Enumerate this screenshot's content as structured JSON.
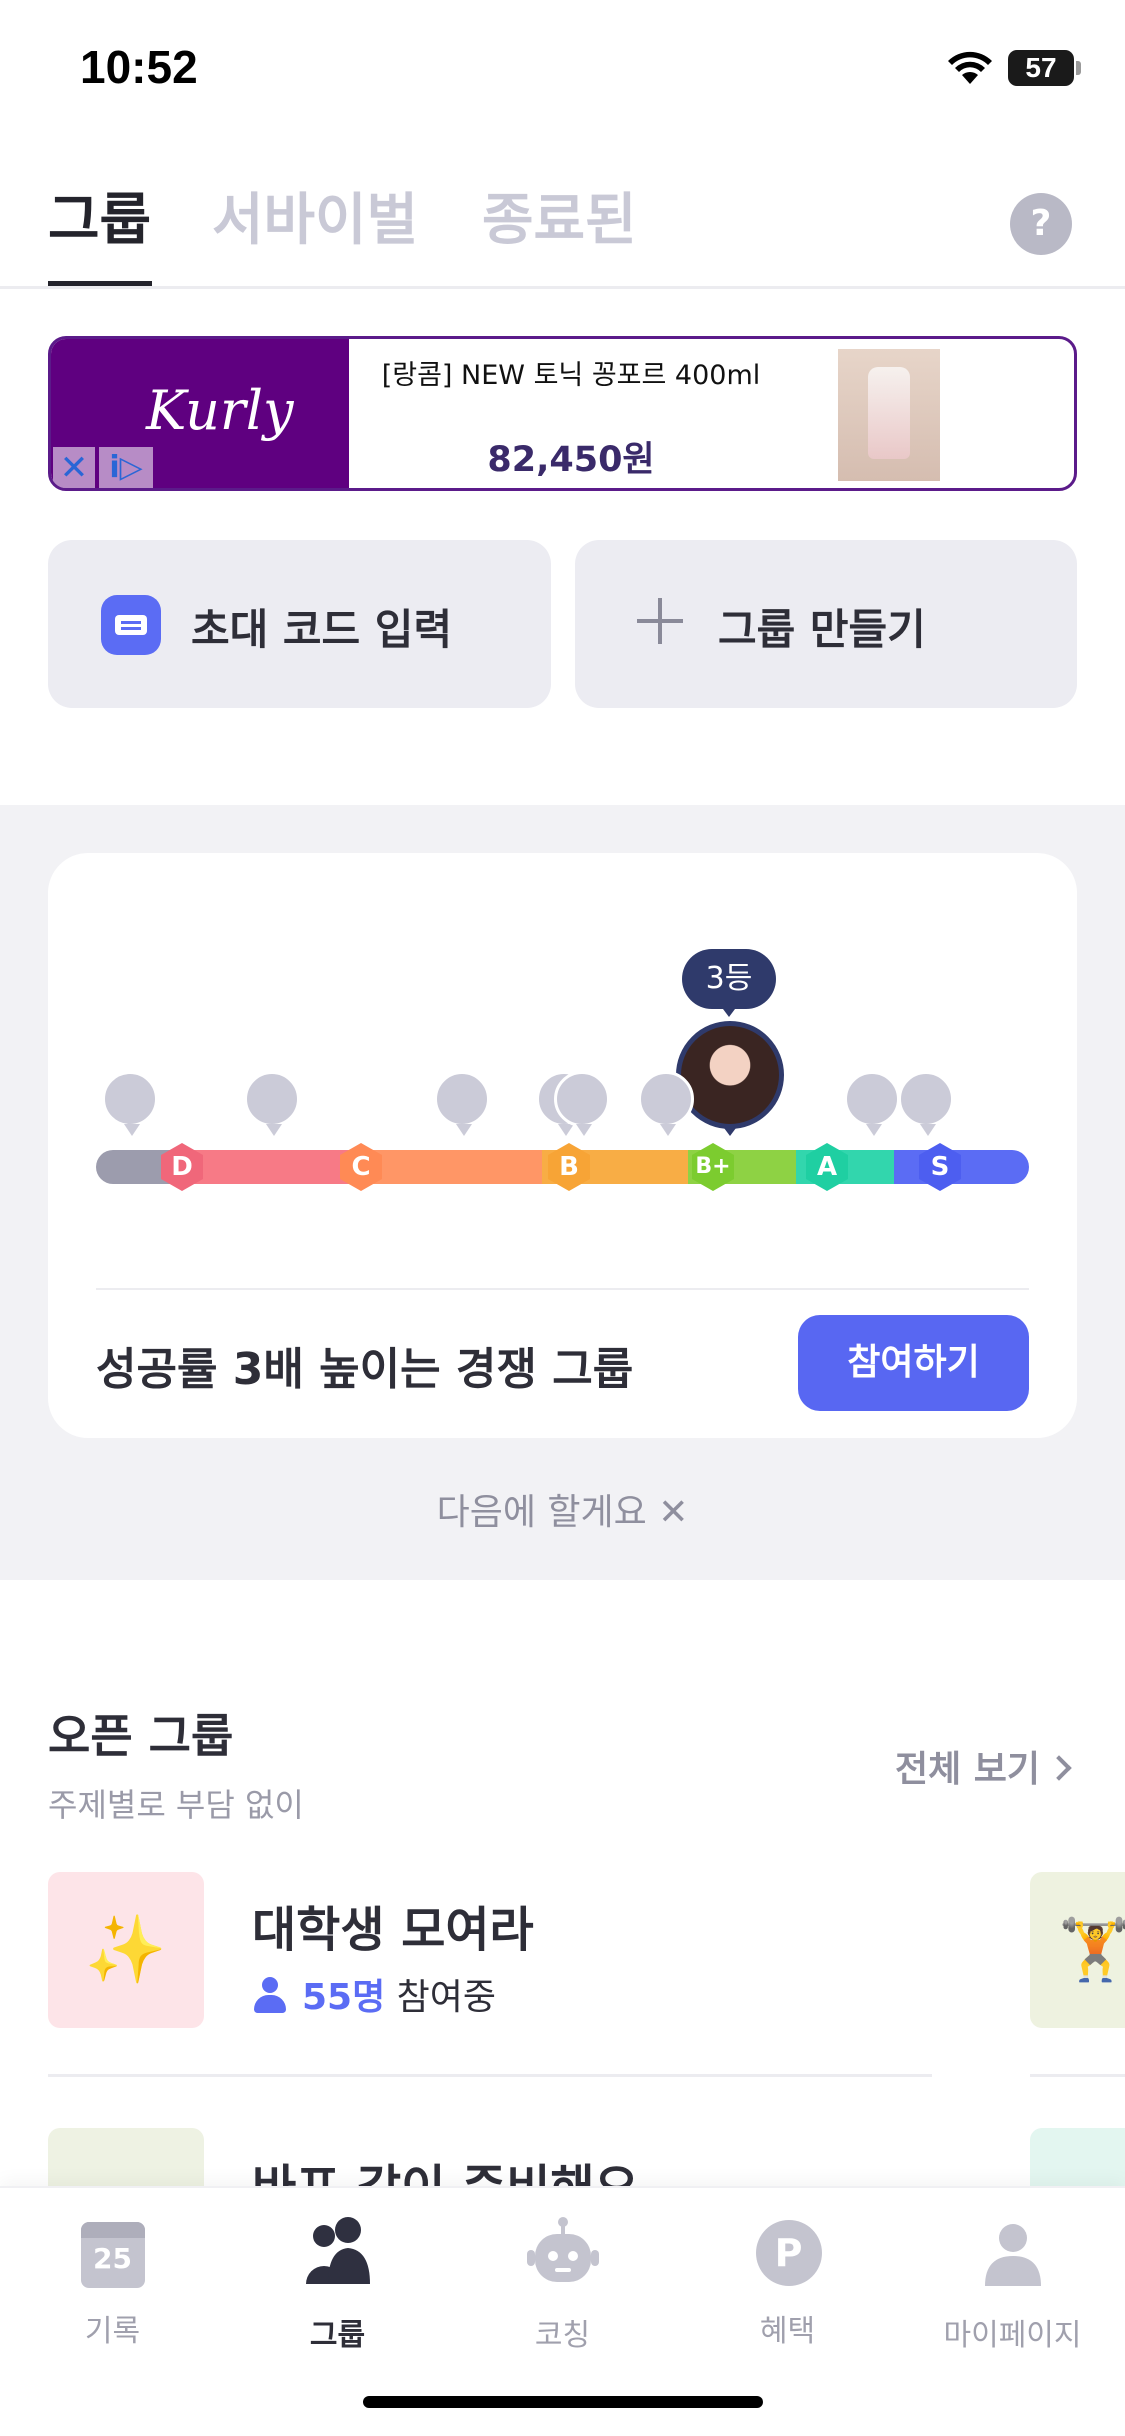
{
  "status_bar": {
    "time": "10:52",
    "battery": "57"
  },
  "tabs": [
    {
      "label": "그룹",
      "active": true
    },
    {
      "label": "서바이벌",
      "active": false
    },
    {
      "label": "종료된",
      "active": false
    }
  ],
  "help_label": "?",
  "ad": {
    "brand": "Kurly",
    "title": "[랑콤] NEW 토닉 꽁포르 400ml",
    "price": "82,450원",
    "close_glyph": "✕",
    "info_glyph": "i▷"
  },
  "actions": {
    "invite_label": "초대 코드 입력",
    "create_label": "그룹 만들기"
  },
  "promo": {
    "rank": "3등",
    "grades": [
      "D",
      "C",
      "B",
      "B+",
      "A",
      "S"
    ],
    "text": "성공률 3배 높이는 경쟁 그룹",
    "join_label": "참여하기",
    "dismiss_label": "다음에 할게요 ✕"
  },
  "open_groups": {
    "title": "오픈 그룹",
    "subtitle": "주제별로 부담 없이",
    "see_all": "전체 보기",
    "items": [
      {
        "name": "대학생 모여라",
        "count": "55명",
        "suffix": " 참여중",
        "emoji": "✨",
        "thumb_color": "#fde4e8"
      },
      {
        "name": "바프 같이 준비해요",
        "emoji": "",
        "thumb_color": "#eef2e3"
      }
    ],
    "side_items": [
      {
        "emoji": "🏋",
        "thumb_color": "#eef2e0"
      },
      {
        "emoji": "",
        "thumb_color": "#e3f6f0"
      }
    ]
  },
  "bottom_nav": [
    {
      "label": "기록",
      "icon": "calendar-icon",
      "day": "25"
    },
    {
      "label": "그룹",
      "icon": "group-icon",
      "active": true
    },
    {
      "label": "코칭",
      "icon": "robot-icon"
    },
    {
      "label": "혜택",
      "icon": "point-icon",
      "glyph": "P"
    },
    {
      "label": "마이페이지",
      "icon": "profile-icon"
    }
  ],
  "colors": {
    "accent": "#5867f2",
    "tab_active": "#24242c",
    "tab_inactive": "#c9c9d6"
  }
}
